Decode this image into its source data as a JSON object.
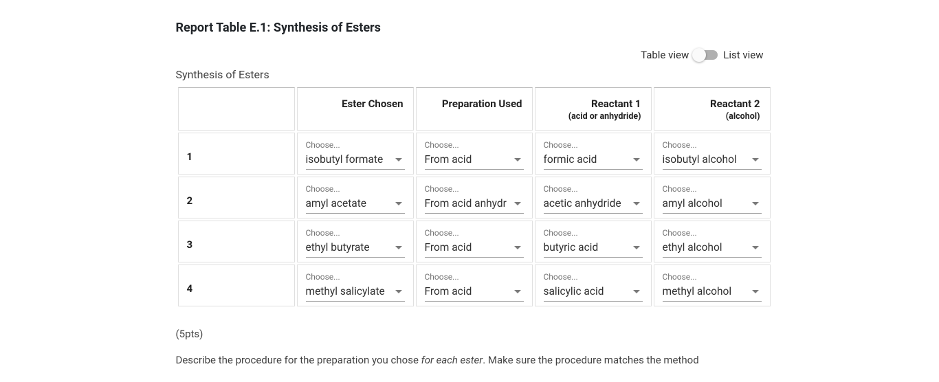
{
  "section_title": "Report Table E.1: Synthesis of Esters",
  "view_toggle": {
    "left_label": "Table view",
    "right_label": "List view"
  },
  "table_caption": "Synthesis of Esters",
  "columns": {
    "ester": {
      "header": "Ester Chosen"
    },
    "prep": {
      "header": "Preparation Used"
    },
    "react1": {
      "header": "Reactant 1",
      "sub": "(acid or anhydride)"
    },
    "react2": {
      "header": "Reactant 2",
      "sub": "(alcohol)"
    }
  },
  "choose_label": "Choose...",
  "rows": [
    {
      "num": "1",
      "ester": "isobutyl formate",
      "prep": "From acid",
      "react1": "formic acid",
      "react2": "isobutyl alcohol"
    },
    {
      "num": "2",
      "ester": "amyl acetate",
      "prep": "From acid anhydr",
      "react1": "acetic anhydride",
      "react2": "amyl alcohol"
    },
    {
      "num": "3",
      "ester": "ethyl butyrate",
      "prep": "From acid",
      "react1": "butyric acid",
      "react2": "ethyl alcohol"
    },
    {
      "num": "4",
      "ester": "methyl salicylate",
      "prep": "From acid",
      "react1": "salicylic acid",
      "react2": "methyl alcohol"
    }
  ],
  "points_label": "(5pts)",
  "instruction": {
    "before": "Describe the procedure for the preparation you chose ",
    "italic": "for each ester",
    "after": ". Make sure the procedure matches the method"
  }
}
